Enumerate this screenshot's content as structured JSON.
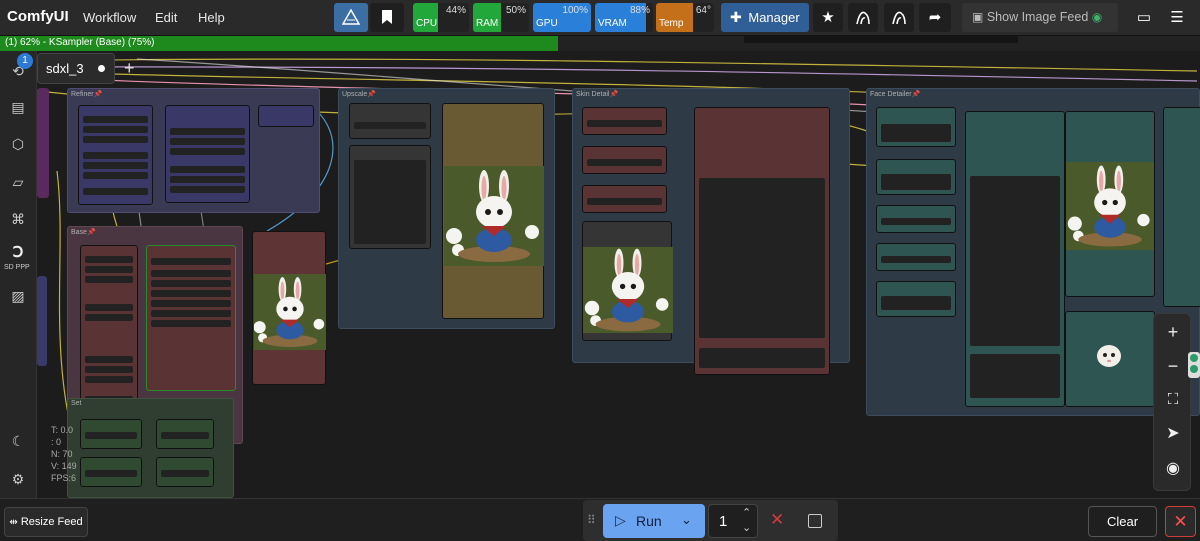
{
  "app": {
    "name": "ComfyUI"
  },
  "menu": {
    "workflow": "Workflow",
    "edit": "Edit",
    "help": "Help"
  },
  "monitors": {
    "cpu": {
      "label": "CPU",
      "pct": "44%",
      "value": 0.44,
      "color": "#22a83a"
    },
    "ram": {
      "label": "RAM",
      "pct": "50%",
      "value": 0.5,
      "color": "#22a83a"
    },
    "gpu": {
      "label": "GPU",
      "pct": "100%",
      "value": 1.0,
      "color": "#2a7fd8"
    },
    "vram": {
      "label": "VRAM",
      "pct": "88%",
      "value": 0.88,
      "color": "#2a7fd8"
    },
    "temp": {
      "label": "Temp",
      "pct": "64°",
      "value": 0.64,
      "color": "#c4701a"
    }
  },
  "toolbar": {
    "manager": "Manager",
    "show_image_feed": "Show Image Feed"
  },
  "progress": {
    "text": "(1) 62% - KSampler (Base) (75%)",
    "value": 0.62,
    "node_value": 0.75
  },
  "workflow_tab": {
    "name": "sdxl_3",
    "badge": "1"
  },
  "sidebar": {
    "sdppp_label": "SD PPP"
  },
  "groups": {
    "refiner": "Refiner📌",
    "upscale": "Upscale📌",
    "skin": "Skin Detail📌",
    "face": "Face Detailer📌",
    "base": "Base📌",
    "settings": "Set"
  },
  "stats": {
    "t": "T: 0.0",
    "i": ": 0",
    "n": "N: 70",
    "v": "V: 149",
    "fps": "FPS:6"
  },
  "bottom": {
    "resize_feed": "Resize Feed",
    "run": "Run",
    "queue_count": "1",
    "clear": "Clear"
  },
  "colors": {
    "accent": "#6aa3ef",
    "progress": "#1e8a1e",
    "danger": "#d33a3a"
  }
}
